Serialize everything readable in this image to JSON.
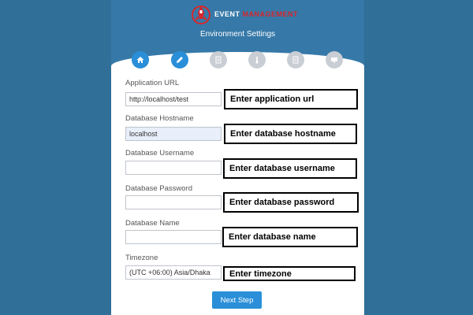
{
  "header": {
    "logo_event": "EVENT",
    "logo_management": "MANAGEMENT",
    "subtitle": "Environment Settings"
  },
  "steps": [
    {
      "icon": "home-icon",
      "active": true
    },
    {
      "icon": "pencil-icon",
      "active": true
    },
    {
      "icon": "document-icon",
      "active": false
    },
    {
      "icon": "thermometer-icon",
      "active": false
    },
    {
      "icon": "document-icon",
      "active": false
    },
    {
      "icon": "monitor-icon",
      "active": false
    }
  ],
  "form": {
    "app_url": {
      "label": "Application URL",
      "value": "http://localhost/test",
      "hint": "Enter application url"
    },
    "db_host": {
      "label": "Database Hostname",
      "value": "localhost",
      "hint": "Enter database hostname"
    },
    "db_user": {
      "label": "Database Username",
      "value": "",
      "hint": "Enter database username"
    },
    "db_pass": {
      "label": "Database Password",
      "value": "",
      "hint": "Enter database password"
    },
    "db_name": {
      "label": "Database Name",
      "value": "",
      "hint": "Enter database name"
    },
    "timezone": {
      "label": "Timezone",
      "value": "(UTC +06:00) Asia/Dhaka",
      "hint": "Enter timezone"
    }
  },
  "next_label": "Next Step",
  "colors": {
    "background": "#2f6f98",
    "header": "#3679a8",
    "accent": "#2a8fd8",
    "inactive_step": "#c9ced4",
    "logo_red": "#d7262c"
  }
}
